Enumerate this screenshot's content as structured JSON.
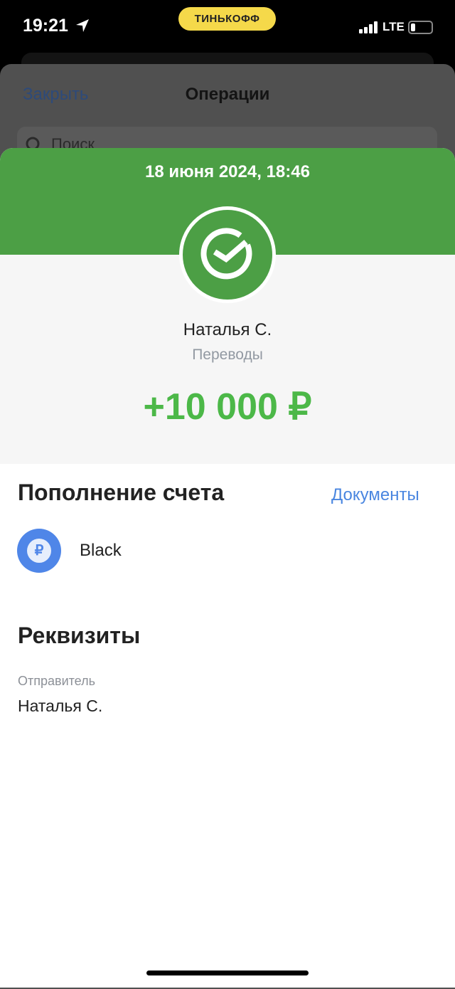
{
  "status_bar": {
    "time": "19:21",
    "carrier_badge": "ТИНЬКОФФ",
    "network": "LTE",
    "battery_percent": 15,
    "icons": [
      "location-arrow-icon",
      "signal-icon",
      "battery-icon"
    ]
  },
  "background_sheet": {
    "close_label": "Закрыть",
    "title": "Операции",
    "search_placeholder": "Поиск"
  },
  "operation": {
    "datetime": "18 июня 2024, 18:46",
    "counterparty": "Наталья С.",
    "category": "Переводы",
    "amount": "+10 000 ₽",
    "icon": "sber-check-icon"
  },
  "section_topup": {
    "title": "Пополнение счета",
    "documents_link": "Документы",
    "account_name": "Black",
    "account_icon": "ruble-icon"
  },
  "section_details": {
    "title": "Реквизиты",
    "sender_label": "Отправитель",
    "sender_value": "Наталья С."
  },
  "colors": {
    "header_green": "#4c9f45",
    "amount_green": "#4cb848",
    "link_blue": "#4a86e0",
    "badge_yellow": "#f5d94a"
  }
}
